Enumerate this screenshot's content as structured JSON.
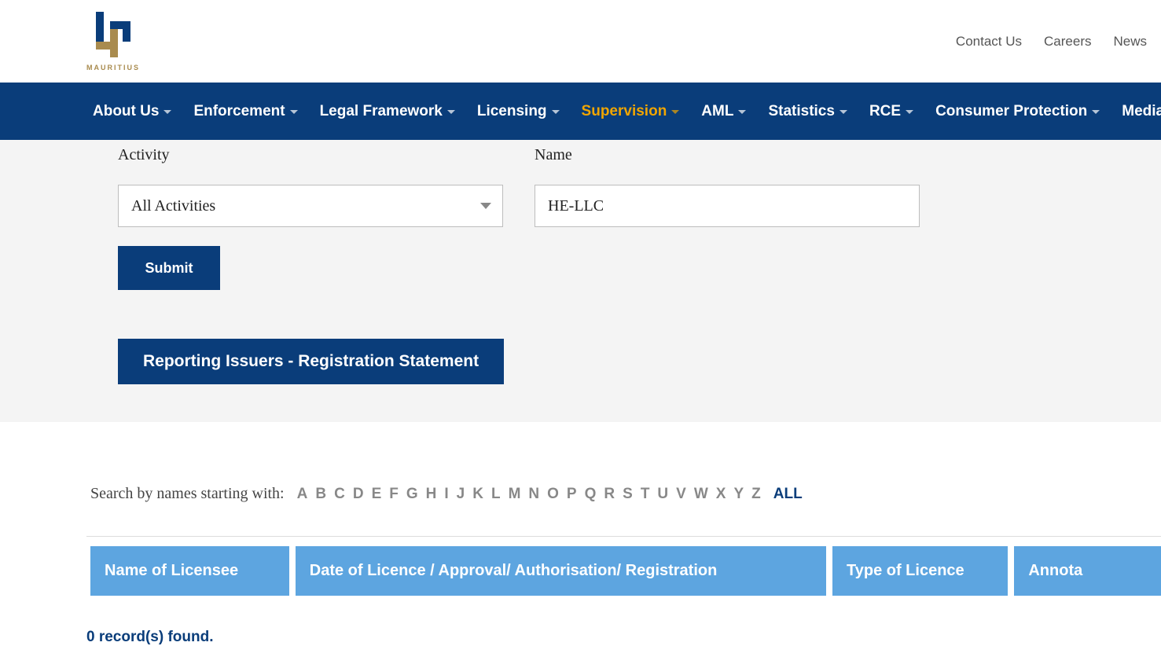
{
  "logo_text": "MAURITIUS",
  "top_links": {
    "contact": "Contact Us",
    "careers": "Careers",
    "news": "News"
  },
  "nav": {
    "about": "About Us",
    "enforcement": "Enforcement",
    "legal": "Legal Framework",
    "licensing": "Licensing",
    "supervision": "Supervision",
    "aml": "AML",
    "statistics": "Statistics",
    "rce": "RCE",
    "consumer": "Consumer Protection",
    "media": "Media Co"
  },
  "form": {
    "activity_label": "Activity",
    "activity_value": "All Activities",
    "name_label": "Name",
    "name_value": "HE-LLC",
    "submit_label": "Submit",
    "report_label": "Reporting Issuers - Registration Statement"
  },
  "alpha": {
    "prefix": "Search by names starting with:",
    "letters": [
      "A",
      "B",
      "C",
      "D",
      "E",
      "F",
      "G",
      "H",
      "I",
      "J",
      "K",
      "L",
      "M",
      "N",
      "O",
      "P",
      "Q",
      "R",
      "S",
      "T",
      "U",
      "V",
      "W",
      "X",
      "Y",
      "Z"
    ],
    "all": "ALL"
  },
  "table": {
    "col1": "Name of Licensee",
    "col2": "Date of Licence / Approval/ Authorisation/ Registration",
    "col3": "Type of Licence",
    "col4": "Annota"
  },
  "results_text": "0 record(s) found."
}
